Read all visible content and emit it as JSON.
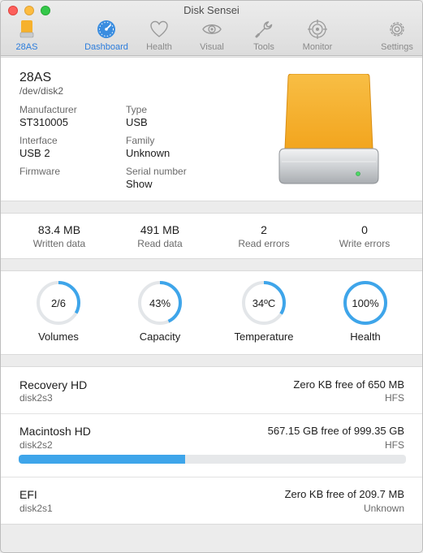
{
  "window": {
    "title": "Disk Sensei"
  },
  "toolbar": {
    "device_label": "28AS",
    "tabs": [
      {
        "label": "Dashboard",
        "icon": "dashboard-icon",
        "active": true
      },
      {
        "label": "Health",
        "icon": "heart-icon",
        "active": false
      },
      {
        "label": "Visual",
        "icon": "eye-icon",
        "active": false
      },
      {
        "label": "Tools",
        "icon": "wrench-icon",
        "active": false
      },
      {
        "label": "Monitor",
        "icon": "crosshair-icon",
        "active": false
      }
    ],
    "settings_label": "Settings"
  },
  "disk": {
    "name": "28AS",
    "path": "/dev/disk2",
    "manufacturer_label": "Manufacturer",
    "manufacturer": "ST310005",
    "type_label": "Type",
    "type": "USB",
    "interface_label": "Interface",
    "interface": "USB 2",
    "family_label": "Family",
    "family": "Unknown",
    "firmware_label": "Firmware",
    "firmware": "",
    "serial_label": "Serial number",
    "serial": "Show"
  },
  "stats": [
    {
      "value": "83.4 MB",
      "label": "Written data"
    },
    {
      "value": "491 MB",
      "label": "Read data"
    },
    {
      "value": "2",
      "label": "Read errors"
    },
    {
      "value": "0",
      "label": "Write errors"
    }
  ],
  "gauges": [
    {
      "text": "2/6",
      "label": "Volumes",
      "fraction": 0.3333
    },
    {
      "text": "43%",
      "label": "Capacity",
      "fraction": 0.43
    },
    {
      "text": "34ºC",
      "label": "Temperature",
      "fraction": 0.34
    },
    {
      "text": "100%",
      "label": "Health",
      "fraction": 1.0
    }
  ],
  "volumes": [
    {
      "name": "Recovery HD",
      "device": "disk2s3",
      "free": "Zero KB free of 650 MB",
      "fs": "HFS"
    },
    {
      "name": "Macintosh HD",
      "device": "disk2s2",
      "free": "567.15 GB free of 999.35 GB",
      "fs": "HFS",
      "used_fraction": 0.43
    },
    {
      "name": "EFI",
      "device": "disk2s1",
      "free": "Zero KB free of 209.7 MB",
      "fs": "Unknown"
    }
  ],
  "colors": {
    "accent": "#2b7cdc",
    "gauge_arc": "#3ea5ea",
    "gauge_track": "#e3e6e9",
    "drive_top": "#f6b12d"
  }
}
